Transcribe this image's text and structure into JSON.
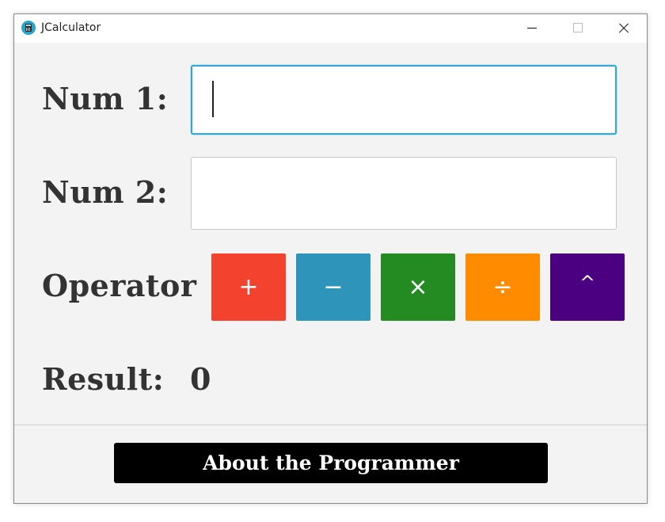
{
  "window": {
    "title": "JCalculator"
  },
  "form": {
    "num1_label": "Num 1:",
    "num1_value": "",
    "num2_label": "Num 2:",
    "num2_value": "",
    "operator_label": "Operator",
    "result_label": "Result:",
    "result_value": "0"
  },
  "operators": [
    {
      "symbol": "+",
      "color": "#f3432e"
    },
    {
      "symbol": "−",
      "color": "#2e94b9"
    },
    {
      "symbol": "×",
      "color": "#238b22"
    },
    {
      "symbol": "÷",
      "color": "#ff8c00"
    },
    {
      "symbol": "^",
      "color": "#4b0082"
    }
  ],
  "footer": {
    "about_label": "About the Programmer"
  },
  "colors": {
    "focus": "#2fa8d8",
    "label": "#333333",
    "background": "#f3f3f3"
  }
}
